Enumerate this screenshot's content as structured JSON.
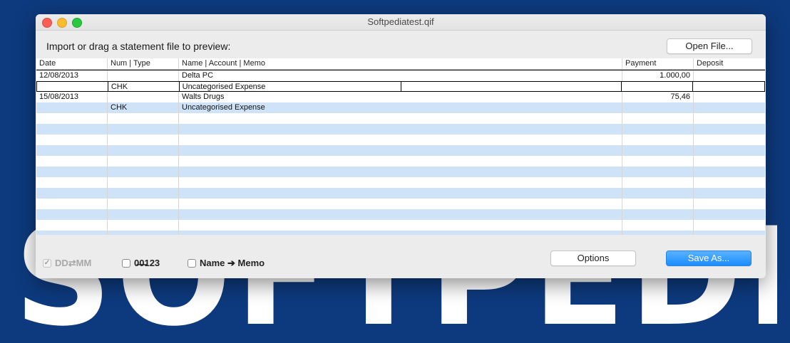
{
  "background": {
    "wordmark": "SOFTPEDIA",
    "color": "#0d3a7e"
  },
  "window": {
    "title": "Softpediatest.qif"
  },
  "toolbar": {
    "prompt": "Import or drag a statement file to preview:",
    "open_file_label": "Open File..."
  },
  "table": {
    "headers": [
      "Date",
      "Num | Type",
      "Name | Account | Memo",
      "Payment",
      "Deposit"
    ],
    "rows": [
      {
        "date": "12/08/2013",
        "num": "",
        "name": "Delta PC",
        "payment": "1.000,00",
        "deposit": ""
      },
      {
        "date": "",
        "num": "CHK",
        "name": "Uncategorised Expense",
        "payment": "",
        "deposit": ""
      },
      {
        "date": "15/08/2013",
        "num": "",
        "name": "Walts Drugs",
        "payment": "75,46",
        "deposit": ""
      },
      {
        "date": "",
        "num": "CHK",
        "name": "Uncategorised Expense",
        "payment": "",
        "deposit": ""
      }
    ]
  },
  "bottom": {
    "date_swap_label": "DD⇄MM",
    "date_swap_checked": true,
    "number_format_label": "0̶0̶123",
    "number_format_checked": false,
    "name_memo_label": "Name ➔ Memo",
    "name_memo_checked": false,
    "options_label": "Options",
    "save_as_label": "Save As..."
  },
  "colors": {
    "accent": "#1a8cff",
    "stripe": "#cfe3f8"
  }
}
